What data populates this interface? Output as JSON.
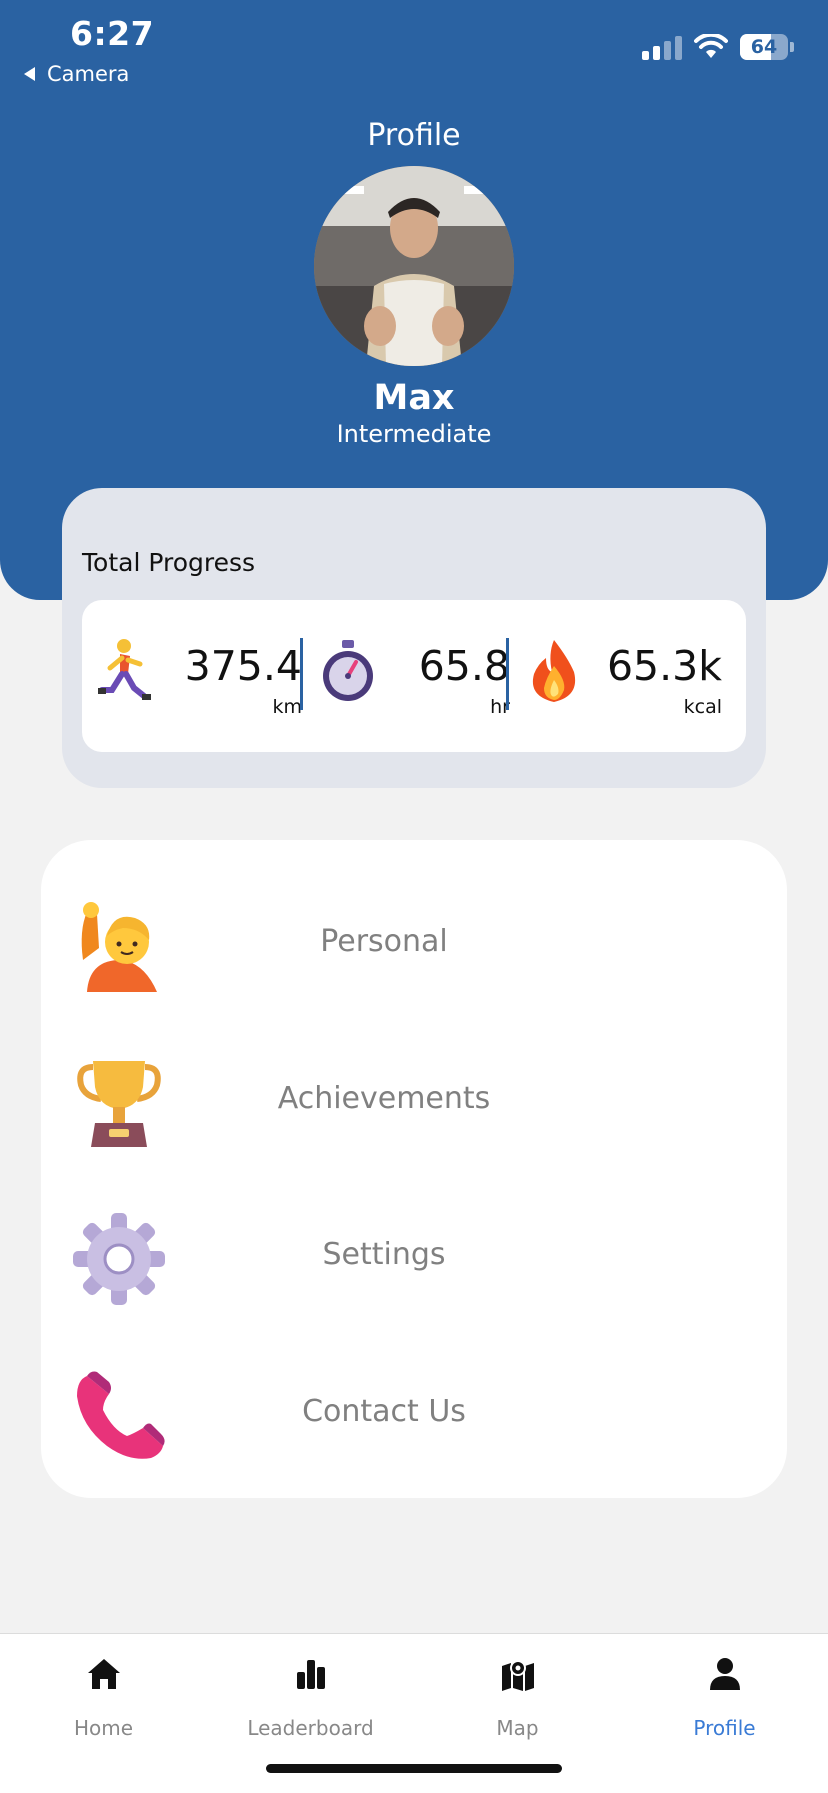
{
  "status_bar": {
    "time": "6:27",
    "back_label": "Camera",
    "battery": "64",
    "battery_level": 0.64
  },
  "header": {
    "title": "Profile",
    "name": "Max",
    "level": "Intermediate"
  },
  "progress": {
    "title": "Total Progress",
    "stats": [
      {
        "icon": "runner-icon",
        "value": "375.4",
        "unit": "km"
      },
      {
        "icon": "stopwatch-icon",
        "value": "65.8",
        "unit": "hr"
      },
      {
        "icon": "fire-icon",
        "value": "65.3k",
        "unit": "kcal"
      }
    ]
  },
  "menu": {
    "items": [
      {
        "icon": "person-raising-hand-icon",
        "label": "Personal"
      },
      {
        "icon": "trophy-icon",
        "label": "Achievements"
      },
      {
        "icon": "gear-icon",
        "label": "Settings"
      },
      {
        "icon": "phone-icon",
        "label": "Contact Us"
      }
    ]
  },
  "tabbar": {
    "active": "Profile",
    "active_color": "#3a7bd5",
    "tabs": [
      {
        "icon": "home-icon",
        "label": "Home"
      },
      {
        "icon": "leaderboard-icon",
        "label": "Leaderboard"
      },
      {
        "icon": "map-icon",
        "label": "Map"
      },
      {
        "icon": "person-icon",
        "label": "Profile"
      }
    ]
  },
  "colors": {
    "header_bg": "#2a62a2",
    "page_bg": "#f2f2f2",
    "card_bg": "#e2e5ec"
  }
}
